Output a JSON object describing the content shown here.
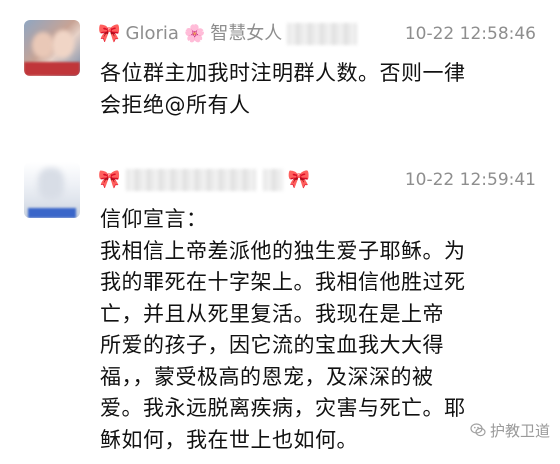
{
  "messages": [
    {
      "sender_prefix": "Gloria",
      "sender_group": "智慧女人",
      "time": "10-22 12:58:46",
      "text": "各位群主加我时注明群人数。否则一律\n会拒绝@所有人"
    },
    {
      "sender_suffix": "",
      "time": "10-22 12:59:41",
      "text": "信仰宣言：\n我相信上帝差派他的独生爱子耶稣。为\n我的罪死在十字架上。我相信他胜过死\n亡，并且从死里复活。我现在是上帝\n所爱的孩子，因它流的宝血我大大得\n福，，蒙受极高的恩宠，及深深的被\n爱。我永远脱离疾病，灾害与死亡。耶\n稣如何，我在世上也如何。"
    }
  ],
  "icons": {
    "bow": "ribbon-bow-icon",
    "flower": "pink-flower-icon",
    "watermark": "wechat-logo-icon"
  },
  "watermark": {
    "text": "护教卫道"
  },
  "colors": {
    "meta_text": "#8e8e8e",
    "body_text": "#111111",
    "bow": "#e75a9a"
  }
}
